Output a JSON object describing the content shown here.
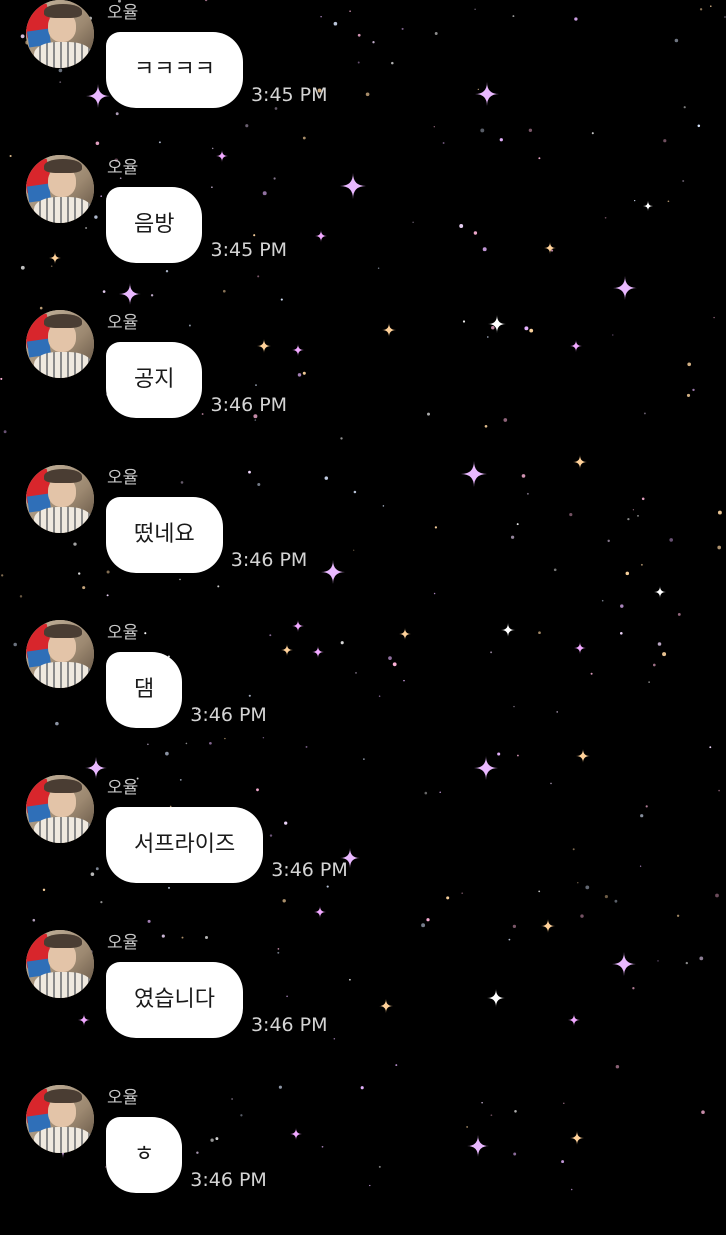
{
  "theme": {
    "background": "#000000",
    "bubble_color": "#ffffff",
    "name_color": "#c8c8c8",
    "time_color": "#d4d4d4"
  },
  "messages": [
    {
      "sender": "오율",
      "text": "ㅋㅋㅋㅋ",
      "time": "3:45 PM"
    },
    {
      "sender": "오율",
      "text": "음방",
      "time": "3:45 PM"
    },
    {
      "sender": "오율",
      "text": "공지",
      "time": "3:46 PM"
    },
    {
      "sender": "오율",
      "text": "떴네요",
      "time": "3:46 PM"
    },
    {
      "sender": "오율",
      "text": "댐",
      "time": "3:46 PM"
    },
    {
      "sender": "오율",
      "text": "서프라이즈",
      "time": "3:46 PM"
    },
    {
      "sender": "오율",
      "text": "였습니다",
      "time": "3:46 PM"
    },
    {
      "sender": "오율",
      "text": "ㅎ",
      "time": "3:46 PM"
    }
  ]
}
